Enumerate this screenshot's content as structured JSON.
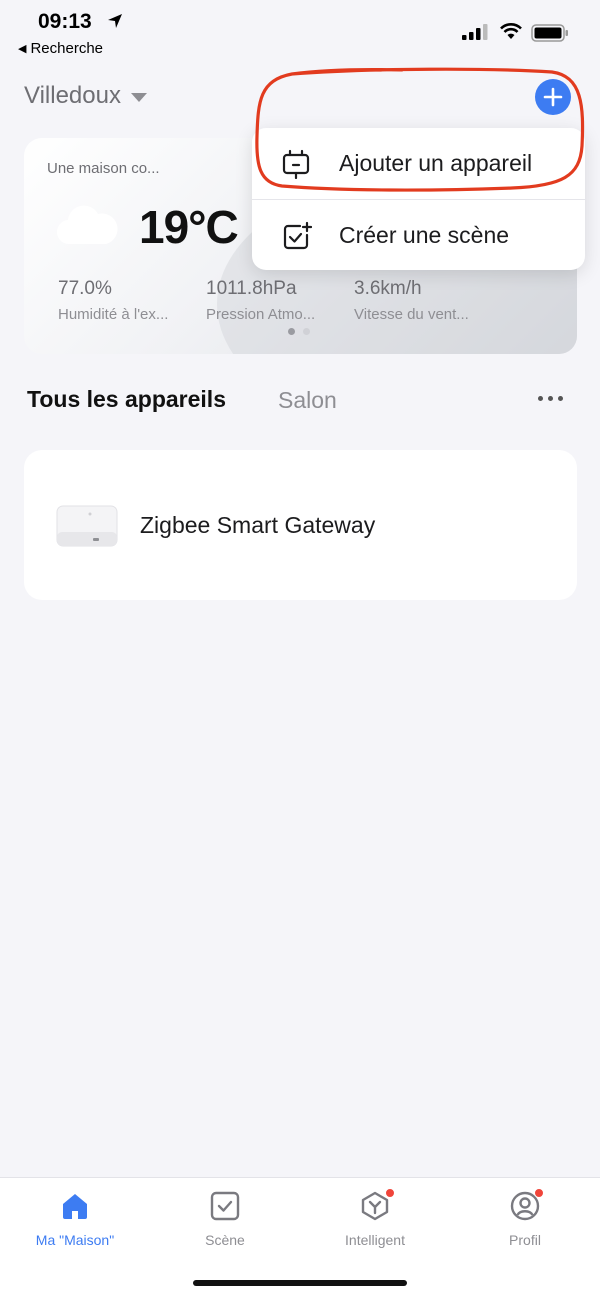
{
  "status_bar": {
    "time": "09:13",
    "back_label": "Recherche"
  },
  "header": {
    "home_name": "Villedoux",
    "add_icon": "plus-icon",
    "accent_color": "#3d7cf2"
  },
  "weather": {
    "home_label": "Une maison co...",
    "condition_icon": "cloud-icon",
    "temperature": "19°C",
    "stats": [
      {
        "value": "77.0%",
        "label": "Humidité à l'ex..."
      },
      {
        "value": "1011.8hPa",
        "label": "Pression Atmo..."
      },
      {
        "value": "3.6km/h",
        "label": "Vitesse du vent..."
      }
    ],
    "page_count": 2,
    "active_page": 1
  },
  "rooms": {
    "tabs": [
      "Tous les appareils",
      "Salon"
    ],
    "active_tab": 0
  },
  "devices": [
    {
      "name": "Zigbee Smart Gateway"
    }
  ],
  "menu": {
    "items": [
      {
        "label": "Ajouter un appareil",
        "icon": "add-device-icon"
      },
      {
        "label": "Créer une scène",
        "icon": "create-scene-icon"
      }
    ],
    "annotation_color": "#e23b1f"
  },
  "tab_bar": {
    "items": [
      {
        "label": "Ma \"Maison\"",
        "icon": "home-icon",
        "active": true,
        "badge": false
      },
      {
        "label": "Scène",
        "icon": "scene-icon",
        "active": false,
        "badge": false
      },
      {
        "label": "Intelligent",
        "icon": "smart-icon",
        "active": false,
        "badge": true
      },
      {
        "label": "Profil",
        "icon": "profile-icon",
        "active": false,
        "badge": true
      }
    ],
    "badge_color": "#f0453a"
  }
}
